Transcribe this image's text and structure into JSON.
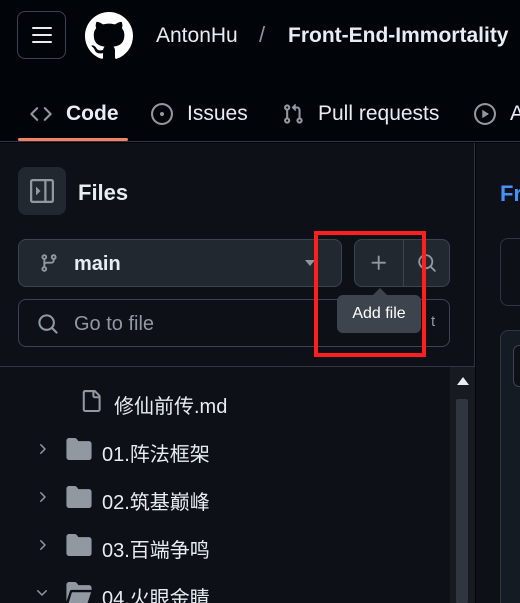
{
  "header": {
    "owner": "AntonHu",
    "separator": "/",
    "repo": "Front-End-Immortality"
  },
  "tabs": [
    {
      "label": "Code",
      "icon": "code-icon",
      "selected": true
    },
    {
      "label": "Issues",
      "icon": "issue-opened-icon"
    },
    {
      "label": "Pull requests",
      "icon": "git-pull-request-icon"
    },
    {
      "label": "A",
      "icon": "play-icon"
    }
  ],
  "sidebar": {
    "title": "Files",
    "branch": "main",
    "search_placeholder": "Go to file",
    "search_kbd": "t",
    "tooltip": "Add file",
    "tree": [
      {
        "label": "修仙前传.md",
        "type": "file"
      },
      {
        "label": "01.阵法框架",
        "type": "folder",
        "expanded": false
      },
      {
        "label": "02.筑基巅峰",
        "type": "folder",
        "expanded": false
      },
      {
        "label": "03.百端争鸣",
        "type": "folder",
        "expanded": false
      },
      {
        "label": "04.火眼金睛",
        "type": "folder",
        "expanded": true
      }
    ]
  },
  "main": {
    "link_text": "Fr"
  },
  "colors": {
    "accent_underline": "#f78166",
    "link": "#4493f8",
    "highlight": "#ff1f1f"
  }
}
